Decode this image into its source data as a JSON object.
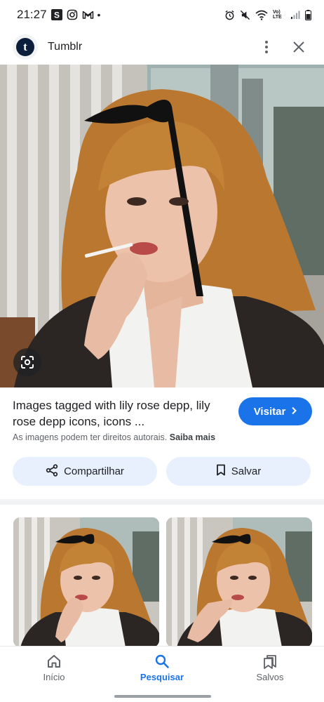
{
  "status_bar": {
    "time": "21:27",
    "left_icons": [
      "s-app-icon",
      "instagram-icon",
      "gmail-icon",
      "dot-icon"
    ],
    "network_label": "Vo) LTE",
    "right_icons": [
      "alarm-icon",
      "mute-icon",
      "wifi-icon",
      "signal-icon",
      "battery-icon"
    ]
  },
  "header": {
    "site_logo_letter": "t",
    "site_name": "Tumblr",
    "menu_icon": "more-vert-icon",
    "close_icon": "close-icon"
  },
  "main_image": {
    "lens_icon": "google-lens-icon"
  },
  "result": {
    "title": "Images tagged with lily rose depp, lily rose depp icons, icons ...",
    "visit_label": "Visitar",
    "rights_text": "As imagens podem ter direitos autorais.",
    "learn_more": "Saiba mais"
  },
  "actions": {
    "share_label": "Compartilhar",
    "save_label": "Salvar"
  },
  "bottom_nav": {
    "items": [
      {
        "label": "Início",
        "icon": "home-icon",
        "active": false
      },
      {
        "label": "Pesquisar",
        "icon": "search-icon",
        "active": true
      },
      {
        "label": "Salvos",
        "icon": "saved-collections-icon",
        "active": false
      }
    ]
  },
  "colors": {
    "accent": "#1a73e8",
    "chip_background": "#e8f0fe",
    "text_primary": "#202124",
    "text_secondary": "#5f6368"
  }
}
